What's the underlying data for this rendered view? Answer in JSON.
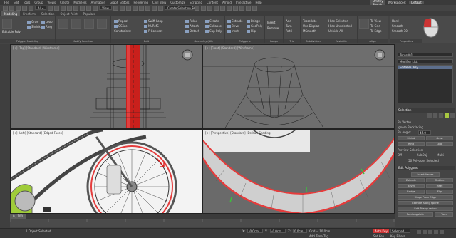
{
  "menu": [
    "File",
    "Edit",
    "Tools",
    "Group",
    "Views",
    "Create",
    "Modifiers",
    "Animation",
    "Graph Editors",
    "Rendering",
    "Civil View",
    "Customize",
    "Scripting",
    "Content",
    "Arnold",
    "Interactive",
    "Help"
  ],
  "user": {
    "name": "Dmitriy Shwab",
    "workspaces_label": "Workspaces:",
    "workspace": "Default"
  },
  "toolbar": {
    "view_dropdown": "View",
    "selection_set": "Create Selection Se"
  },
  "ribbon_tabs": [
    "Modeling",
    "Freeform",
    "Selection",
    "Object Paint",
    "Populate"
  ],
  "ribbon_groups": {
    "polygon_modeling": {
      "label": "Polygon Modeling",
      "edit_poly": "Editable Poly",
      "items": [
        "Grow",
        "Shrink",
        "Loop",
        "Ring"
      ]
    },
    "modify_selection": {
      "label": "Modify Selection"
    },
    "edit": {
      "label": "Edit",
      "items": [
        "Repeat",
        "QSlice",
        "Swift Loop",
        "NURMS",
        "SwiftSlice",
        "P Connect",
        "Constraints:"
      ]
    },
    "geometry": {
      "label": "Geometry (All)",
      "items": [
        "Relax",
        "Create",
        "Attach",
        "Collapse",
        "Detach",
        "Cap Poly"
      ]
    },
    "polygons": {
      "label": "Polygons",
      "items": [
        "Extrude",
        "Bevel",
        "Inset",
        "Outline",
        "Bridge",
        "GeoPoly",
        "Flip"
      ]
    },
    "loops": {
      "label": "Loops",
      "items": [
        "Insert",
        "Remove"
      ]
    },
    "tris": {
      "label": "Tris",
      "items": [
        "Add",
        "Turn",
        "Retri"
      ]
    },
    "subdivision": {
      "label": "Subdivision",
      "items": [
        "Tessellate",
        "Use Displac",
        "MSmooth"
      ]
    },
    "visibility": {
      "label": "Visibility",
      "items": [
        "Hide Selected",
        "Hide Unselected",
        "Unhide All"
      ]
    },
    "align": {
      "label": "Align",
      "items": [
        "Make Planar",
        "To View",
        "To Grid",
        "To Edge"
      ]
    },
    "properties": {
      "label": "Properties",
      "items": [
        "Hard",
        "Smooth",
        "Smooth 30"
      ]
    }
  },
  "viewports": {
    "top_left": {
      "label": "[+] [Top] [Standard] [Wireframe]"
    },
    "top_right": {
      "label": "[+] [Front] [Standard] [Wireframe]"
    },
    "bottom_left": {
      "label": "[+] [Left] [Standard] [Edged Faces]"
    },
    "bottom_right": {
      "label": "[+] [Perspective] [Standard] [Default Shading]"
    }
  },
  "command_panel": {
    "object_name": "Torus001",
    "modifier_list_label": "Modifier List",
    "stack_item": "Editable Poly",
    "selection_head": "Selection",
    "by_vertex": "By Vertex",
    "ignore_backfacing": "Ignore Backfacing",
    "by_angle_label": "By Angle:",
    "by_angle_value": "45.0",
    "shrink": "Shrink",
    "grow": "Grow",
    "ring": "Ring",
    "loop": "Loop",
    "preview_label": "Preview Selection",
    "preview_off": "Off",
    "preview_subobj": "SubObj",
    "preview_multi": "Multi",
    "selected_status": "56 Polygons Selected",
    "edit_polygons_head": "Edit Polygons",
    "insert_vertex": "Insert Vertex",
    "extrude": "Extrude",
    "outline": "Outline",
    "bevel": "Bevel",
    "inset": "Inset",
    "bridge": "Bridge",
    "flip": "Flip",
    "hinge": "Hinge From Edge",
    "extrude_spline": "Extrude Along Spline",
    "edit_tri": "Edit Triangulation",
    "retriangulate": "Retriangulate",
    "turn": "Turn"
  },
  "timeline": {
    "frame": "0 / 100"
  },
  "status": {
    "objects_selected": "1 Object Selected",
    "x_label": "X:",
    "x_value": "-0.0cm",
    "y_label": "Y:",
    "y_value": "-0.0cm",
    "z_label": "Z:",
    "z_value": "0.0cm",
    "grid": "Grid = 10.0cm",
    "add_time_tag": "Add Time Tag",
    "auto_key": "Auto Key",
    "selected": "Selected",
    "set_key": "Set Key",
    "key_filters": "Key Filters..."
  }
}
